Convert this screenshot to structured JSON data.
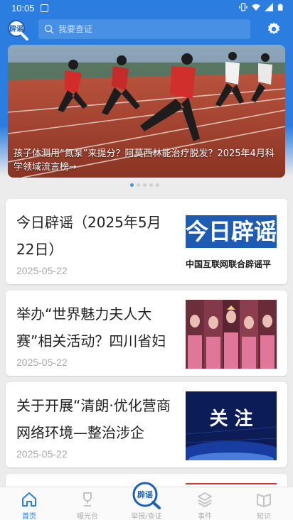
{
  "status_bar": {
    "time": "10:05"
  },
  "header": {
    "logo_text": "辟谣",
    "search_placeholder": "我要查证"
  },
  "banner": {
    "caption": "孩子体测用“氮泵”来提分？阿莫西林能治疗脱发？2025年4月科学领域流言榜→",
    "slide_count": 5,
    "active_slide": 0
  },
  "articles": [
    {
      "title": "今日辟谣（2025年5月22日）",
      "date": "2025-05-22",
      "thumb_big": "今日辟谣",
      "thumb_small": "中国互联网联合辟谣平"
    },
    {
      "title": "举办“世界魅力夫人大赛”相关活动？四川省妇",
      "date": "2025-05-22"
    },
    {
      "title": "关于开展“清朗·优化营商网络环境—整治涉企",
      "date": "2025-05-22",
      "thumb_big": "关 注"
    }
  ],
  "tabs": [
    {
      "label": "首页",
      "icon": "home-icon",
      "active": true
    },
    {
      "label": "曝光台",
      "icon": "trophy-icon",
      "active": false
    },
    {
      "label": "举报/查证",
      "icon": "search-logo-icon",
      "active": false
    },
    {
      "label": "事件",
      "icon": "layers-icon",
      "active": false
    },
    {
      "label": "知识",
      "icon": "book-icon",
      "active": false
    }
  ],
  "colors": {
    "primary": "#2b7ee0",
    "background": "#ececec",
    "inactive": "#b0b0b0"
  }
}
